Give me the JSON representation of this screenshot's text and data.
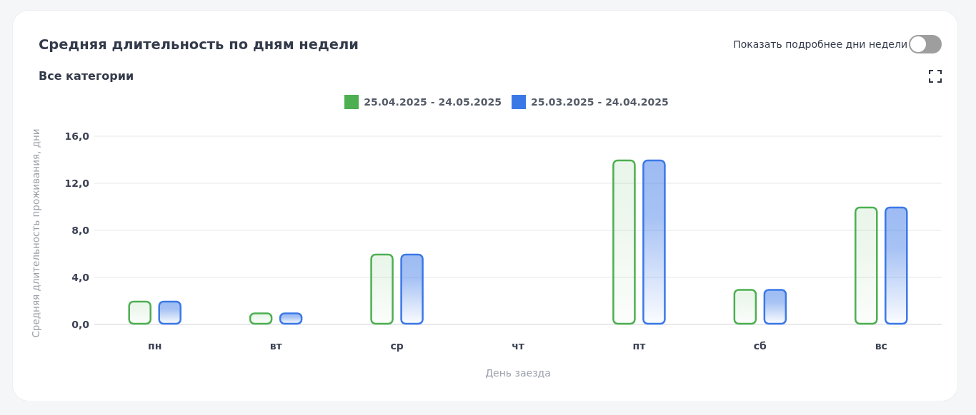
{
  "card": {
    "title": "Средняя длительность по дням недели",
    "toggle": {
      "label": "Показать подробнее дни недели",
      "on": false
    },
    "subtitle": "Все категории",
    "chart_data": {
      "type": "bar",
      "xlabel": "День заезда",
      "ylabel": "Средняя длительность проживания, дни",
      "categories": [
        "пн",
        "вт",
        "ср",
        "чт",
        "пт",
        "сб",
        "вс"
      ],
      "series": [
        {
          "name": "25.04.2025 - 24.05.2025",
          "color": "#4caf50",
          "values": [
            2,
            1,
            6,
            0,
            14,
            3,
            10
          ]
        },
        {
          "name": "25.03.2025 - 24.04.2025",
          "color": "#3b78e7",
          "values": [
            2,
            1,
            6,
            0,
            14,
            3,
            10
          ]
        }
      ],
      "ylim": [
        0,
        16
      ],
      "grid": true,
      "yticks": [
        {
          "value": 0,
          "label": "0,0"
        },
        {
          "value": 4,
          "label": "4,0"
        },
        {
          "value": 8,
          "label": "8,0"
        },
        {
          "value": 12,
          "label": "12,0"
        },
        {
          "value": 16,
          "label": "16,0"
        }
      ]
    }
  }
}
